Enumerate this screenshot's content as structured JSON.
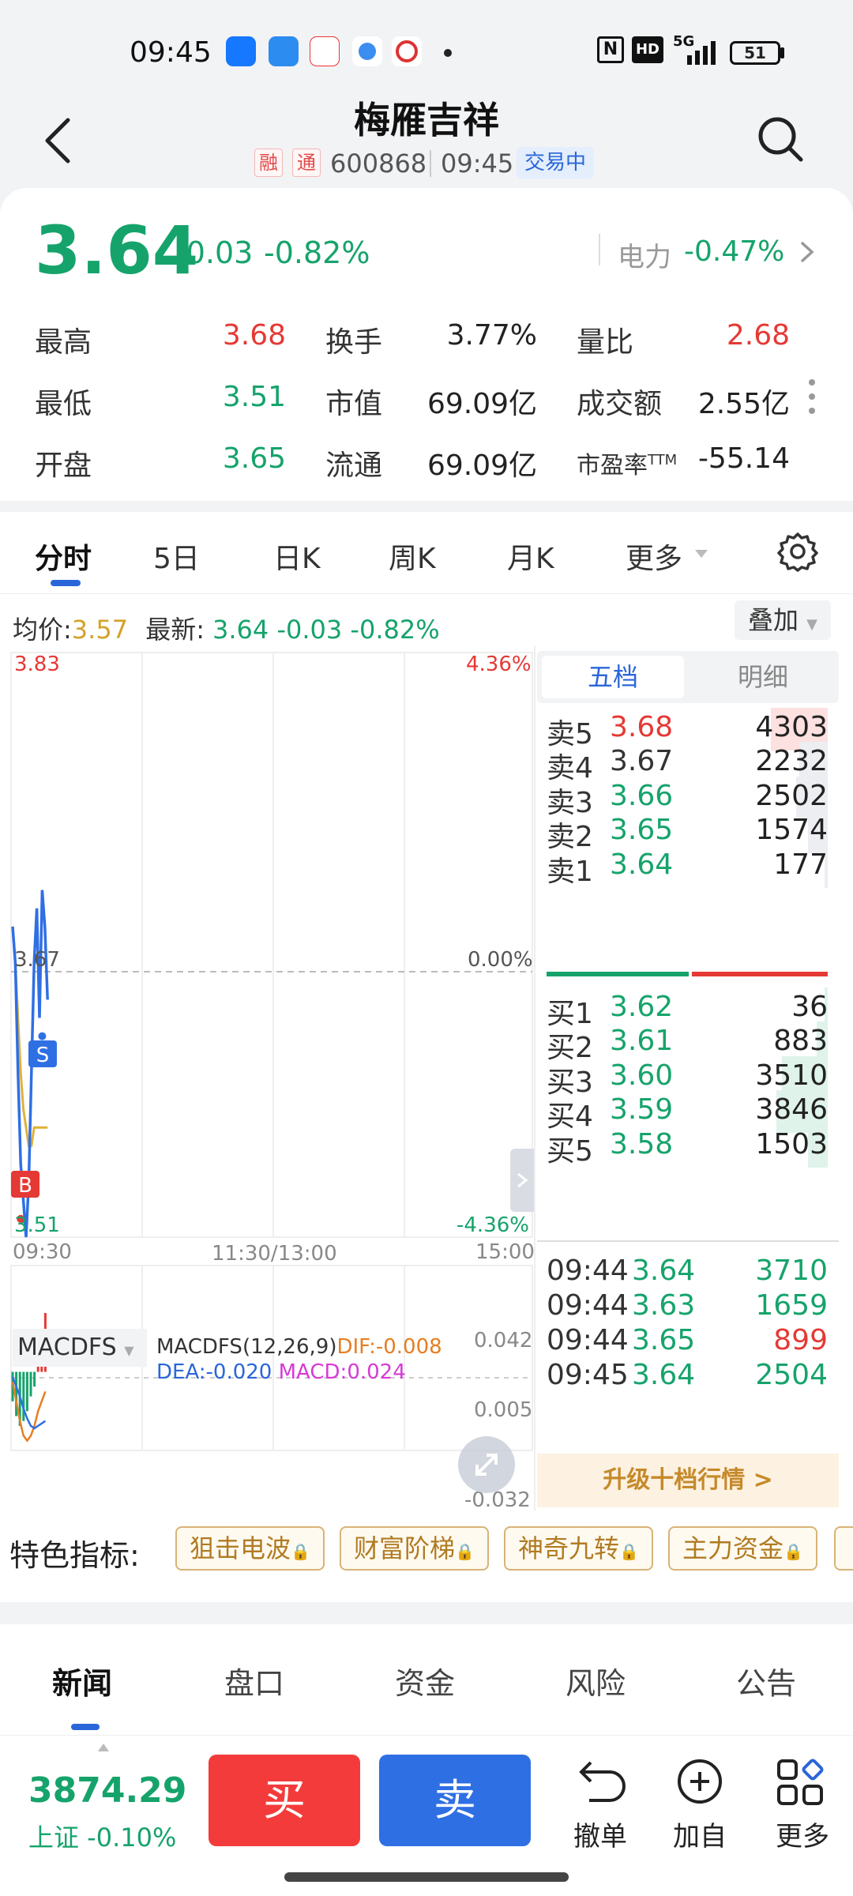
{
  "status_bar": {
    "time": "09:45",
    "battery": "51",
    "network": "5G",
    "hd": "HD",
    "nfc": "N"
  },
  "header": {
    "title": "梅雁吉祥",
    "tags": [
      "融",
      "通"
    ],
    "code": "600868",
    "time": "09:45",
    "status": "交易中"
  },
  "quote": {
    "price": "3.64",
    "change": "-0.03",
    "change_pct": "-0.82%",
    "sector_name": "电力",
    "sector_pct": "-0.47%",
    "stats": [
      {
        "label": "最高",
        "value": "3.68"
      },
      {
        "label": "换手",
        "value": "3.77%"
      },
      {
        "label": "量比",
        "value": "2.68"
      },
      {
        "label": "最低",
        "value": "3.51"
      },
      {
        "label": "市值",
        "value": "69.09亿"
      },
      {
        "label": "成交额",
        "value": "2.55亿"
      },
      {
        "label": "开盘",
        "value": "3.65"
      },
      {
        "label": "流通",
        "value": "69.09亿"
      },
      {
        "label": "市盈率",
        "label_sup": "TTM",
        "value": "-55.14"
      }
    ]
  },
  "chart_tabs": [
    "分时",
    "5日",
    "日K",
    "周K",
    "月K",
    "更多"
  ],
  "chart_info": {
    "avg_label": "均价:",
    "avg_value": "3.57",
    "latest_label": "最新:",
    "latest_value": "3.64 -0.03 -0.82%",
    "overlay_label": "叠加"
  },
  "chart_data": {
    "type": "line",
    "price_axis": {
      "top": "3.83",
      "mid": "3.67",
      "bottom": "3.51"
    },
    "pct_axis": {
      "top": "4.36%",
      "mid": "0.00%",
      "bottom": "-4.36%"
    },
    "time_axis": [
      "09:30",
      "11:30/13:00",
      "15:00"
    ],
    "ylim": [
      3.51,
      3.83
    ],
    "prev_close": 3.67,
    "price_series": [
      3.68,
      3.66,
      3.6,
      3.55,
      3.53,
      3.51,
      3.54,
      3.6,
      3.66,
      3.69,
      3.63,
      3.7,
      3.68,
      3.64
    ],
    "avg_series": [
      3.68,
      3.66,
      3.63,
      3.6,
      3.58,
      3.57,
      3.56,
      3.56,
      3.57,
      3.57,
      3.57,
      3.57,
      3.57,
      3.57
    ],
    "markers": [
      {
        "label": "S"
      },
      {
        "label": "B"
      }
    ],
    "macd": {
      "name": "MACDFS",
      "params": "MACDFS(12,26,9)",
      "dif": "DIF:-0.008",
      "dea": "DEA:-0.020",
      "macd": "MACD:0.024",
      "axis": [
        "0.042",
        "0.005",
        "-0.032"
      ],
      "ylim": [
        -0.032,
        0.042
      ],
      "bars": [
        -0.012,
        -0.018,
        -0.022,
        -0.02,
        -0.016,
        -0.01,
        -0.006,
        0.004,
        0.014,
        0.024
      ],
      "dif_series": [
        -0.004,
        -0.012,
        -0.02,
        -0.026,
        -0.028,
        -0.026,
        -0.022,
        -0.016,
        -0.012,
        -0.008
      ],
      "dea_series": [
        -0.002,
        -0.006,
        -0.01,
        -0.015,
        -0.019,
        -0.022,
        -0.023,
        -0.022,
        -0.021,
        -0.02
      ]
    }
  },
  "order_book": {
    "tabs": [
      "五档",
      "明细"
    ],
    "asks": [
      {
        "label": "卖5",
        "price": "3.68",
        "volume": "4303",
        "share": 0.2
      },
      {
        "label": "卖4",
        "price": "3.67",
        "volume": "2232",
        "share": 0.1
      },
      {
        "label": "卖3",
        "price": "3.66",
        "volume": "2502",
        "share": 0.11
      },
      {
        "label": "卖2",
        "price": "3.65",
        "volume": "1574",
        "share": 0.07
      },
      {
        "label": "卖1",
        "price": "3.64",
        "volume": "177",
        "share": 0.01
      }
    ],
    "bids": [
      {
        "label": "买1",
        "price": "3.62",
        "volume": "36",
        "share": 0.01
      },
      {
        "label": "买2",
        "price": "3.61",
        "volume": "883",
        "share": 0.04
      },
      {
        "label": "买3",
        "price": "3.60",
        "volume": "3510",
        "share": 0.16
      },
      {
        "label": "买4",
        "price": "3.59",
        "volume": "3846",
        "share": 0.18
      },
      {
        "label": "买5",
        "price": "3.58",
        "volume": "1503",
        "share": 0.07
      }
    ],
    "ticks": [
      {
        "time": "09:44",
        "price": "3.64",
        "volume": "3710",
        "dir": "down"
      },
      {
        "time": "09:44",
        "price": "3.63",
        "volume": "1659",
        "dir": "down"
      },
      {
        "time": "09:44",
        "price": "3.65",
        "volume": "899",
        "dir": "up"
      },
      {
        "time": "09:45",
        "price": "3.64",
        "volume": "2504",
        "dir": "down"
      }
    ],
    "upgrade_label": "升级十档行情 >"
  },
  "features": {
    "label": "特色指标:",
    "items": [
      "狙击电波",
      "财富阶梯",
      "神奇九转",
      "主力资金"
    ]
  },
  "news_tabs": [
    "新闻",
    "盘口",
    "资金",
    "风险",
    "公告"
  ],
  "bottom": {
    "index_value": "3874.29",
    "index_name": "上证 -0.10%",
    "buy_label": "买",
    "sell_label": "卖",
    "tools": [
      "撤单",
      "加自选",
      "更多"
    ]
  },
  "colors": {
    "up": "#e53935",
    "down": "#16a36b",
    "buy_btn": "#f43b3b",
    "sell_btn": "#2f6fe4",
    "accent": "#2a66d9"
  }
}
